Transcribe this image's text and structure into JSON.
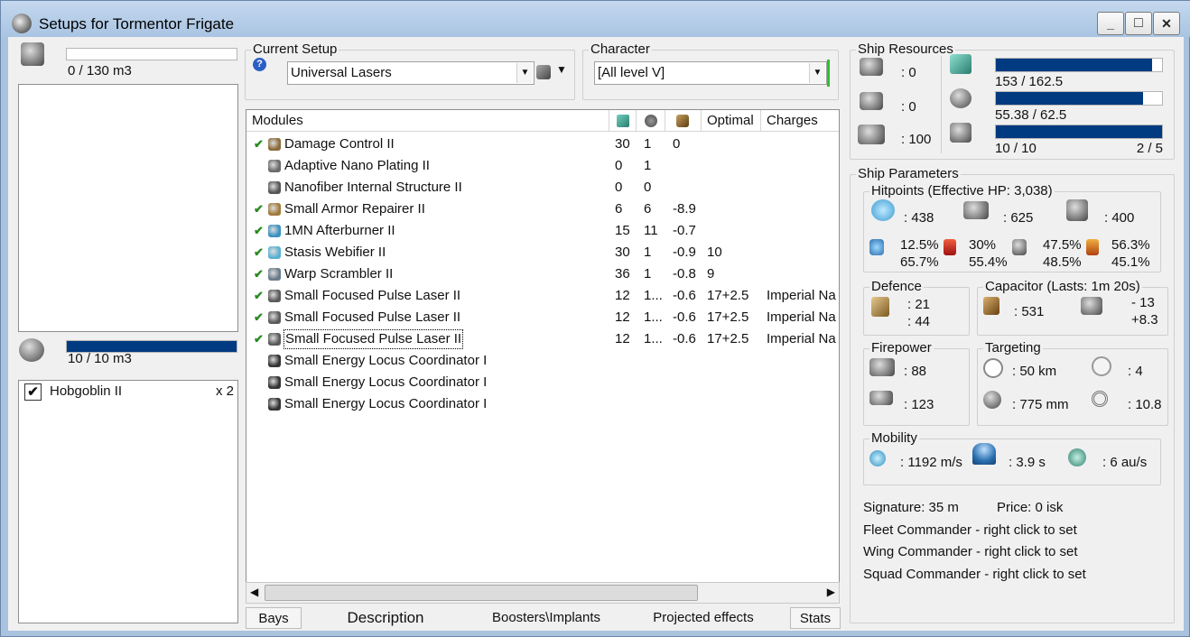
{
  "window": {
    "title": "Setups for Tormentor Frigate",
    "controls": [
      "_",
      "□",
      "✕"
    ]
  },
  "left": {
    "cargo_text": "0 / 130 m3",
    "cargo_fill": 0,
    "drone_bay_text": "10 / 10 m3",
    "drone_bay_fill": 1.0,
    "drones": [
      {
        "checked": true,
        "name": "Hobgoblin II",
        "count": "x 2"
      }
    ]
  },
  "setup": {
    "group_label": "Current Setup",
    "value": "Universal Lasers",
    "help_glyph": "?"
  },
  "character": {
    "group_label": "Character",
    "value": "[All level V]"
  },
  "modules": {
    "headers": [
      "Modules",
      "",
      "",
      "",
      "Optimal",
      "Charges"
    ],
    "rows": [
      {
        "active": true,
        "name": "Damage Control II",
        "c1": "30",
        "c2": "1",
        "c3": "0",
        "optimal": "",
        "charges": ""
      },
      {
        "active": false,
        "name": "Adaptive Nano Plating II",
        "c1": "0",
        "c2": "1",
        "c3": "",
        "optimal": "",
        "charges": ""
      },
      {
        "active": false,
        "name": "Nanofiber Internal Structure II",
        "c1": "0",
        "c2": "0",
        "c3": "",
        "optimal": "",
        "charges": ""
      },
      {
        "active": true,
        "name": "Small Armor Repairer II",
        "c1": "6",
        "c2": "6",
        "c3": "-8.9",
        "optimal": "",
        "charges": ""
      },
      {
        "active": true,
        "name": "1MN Afterburner II",
        "c1": "15",
        "c2": "11",
        "c3": "-0.7",
        "optimal": "",
        "charges": ""
      },
      {
        "active": true,
        "name": "Stasis Webifier II",
        "c1": "30",
        "c2": "1",
        "c3": "-0.9",
        "optimal": "10",
        "charges": ""
      },
      {
        "active": true,
        "name": "Warp Scrambler II",
        "c1": "36",
        "c2": "1",
        "c3": "-0.8",
        "optimal": "9",
        "charges": ""
      },
      {
        "active": true,
        "name": "Small Focused Pulse Laser II",
        "c1": "12",
        "c2": "1...",
        "c3": "-0.6",
        "optimal": "17+2.5",
        "charges": "Imperial Na"
      },
      {
        "active": true,
        "name": "Small Focused Pulse Laser II",
        "c1": "12",
        "c2": "1...",
        "c3": "-0.6",
        "optimal": "17+2.5",
        "charges": "Imperial Na"
      },
      {
        "active": true,
        "name": "Small Focused Pulse Laser II",
        "c1": "12",
        "c2": "1...",
        "c3": "-0.6",
        "optimal": "17+2.5",
        "charges": "Imperial Na",
        "selected": true
      },
      {
        "active": false,
        "name": "Small Energy Locus Coordinator I",
        "c1": "",
        "c2": "",
        "c3": "",
        "optimal": "",
        "charges": ""
      },
      {
        "active": false,
        "name": "Small Energy Locus Coordinator I",
        "c1": "",
        "c2": "",
        "c3": "",
        "optimal": "",
        "charges": ""
      },
      {
        "active": false,
        "name": "Small Energy Locus Coordinator I",
        "c1": "",
        "c2": "",
        "c3": "",
        "optimal": "",
        "charges": ""
      }
    ]
  },
  "tabs": [
    "Bays",
    "Description",
    "Boosters\\Implants",
    "Projected effects",
    "Stats"
  ],
  "resources": {
    "group_label": "Ship Resources",
    "turret": ": 0",
    "launcher": ": 0",
    "calibration": ": 100",
    "cpu_text": "153 / 162.5",
    "cpu_fill": 0.94,
    "pg_text": "55.38 / 62.5",
    "pg_fill": 0.886,
    "drone_bw_text": "10 / 10",
    "drone_bw_fill": 1.0,
    "drones_active": "2 / 5"
  },
  "params": {
    "group_label": "Ship Parameters",
    "hitpoints_label": "Hitpoints (Effective HP: 3,038)",
    "shield_hp": ": 438",
    "armor_hp": ": 625",
    "hull_hp": ": 400",
    "res_em_top": "12.5%",
    "res_em_bottom": "65.7%",
    "res_th_top": "30%",
    "res_th_bottom": "55.4%",
    "res_kin_top": "47.5%",
    "res_kin_bottom": "48.5%",
    "res_exp_top": "56.3%",
    "res_exp_bottom": "45.1%",
    "defence_label": "Defence",
    "def_1": ": 21",
    "def_2": ": 44",
    "capacitor_label": "Capacitor (Lasts: 1m 20s)",
    "cap_amount": ": 531",
    "cap_delta_1": "- 13",
    "cap_delta_2": "+8.3",
    "firepower_label": "Firepower",
    "fp_1": ": 88",
    "fp_2": ": 123",
    "targeting_label": "Targeting",
    "target_range": ": 50 km",
    "max_targets": ": 4",
    "scan_res": ": 775 mm",
    "sensor_str": ": 10.8",
    "mobility_label": "Mobility",
    "speed": ": 1192 m/s",
    "align": ": 3.9 s",
    "warp": ": 6 au/s",
    "signature": "Signature: 35 m",
    "price": "Price: 0 isk",
    "fleet": "Fleet Commander - right click to set",
    "wing": "Wing Commander - right click to set",
    "squad": "Squad Commander - right click to set"
  },
  "colors": {
    "bar": "#003a80",
    "check": "#2a8b22",
    "title_bg": "#a9c4e3"
  }
}
